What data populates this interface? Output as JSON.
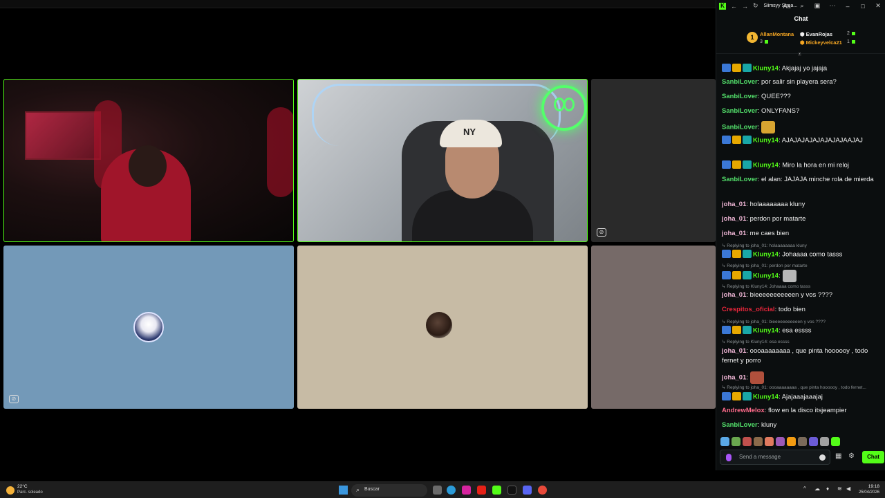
{
  "window": {
    "title": "Siimsyy Strea...",
    "chat_title": "Chat"
  },
  "gifters": {
    "first": {
      "rank": "1",
      "name": "AllanMontana",
      "count": "3"
    },
    "second": {
      "name": "EvanRojas",
      "count": "2"
    },
    "third": {
      "name": "Mickeyvelca21",
      "count": "1"
    }
  },
  "messages": [
    {
      "user": "Kluny14",
      "color": "#53fc18",
      "badges": true,
      "text": " Akjajaj yo jajaja"
    },
    {
      "user": "SanbiLover",
      "color": "#53e06b",
      "badges": false,
      "text": " por salir sin playera sera?"
    },
    {
      "user": "SanbiLover",
      "color": "#53e06b",
      "badges": false,
      "text": " QUEE???"
    },
    {
      "user": "SanbiLover",
      "color": "#53e06b",
      "badges": false,
      "text": " ONLYFANS?"
    },
    {
      "user": "SanbiLover",
      "color": "#53e06b",
      "badges": false,
      "text": ""
    },
    {
      "user": "Kluny14",
      "color": "#53fc18",
      "badges": true,
      "text": " AJAJAJAJAJAJAJAJAAJAJ"
    },
    {
      "user": "Kluny14",
      "color": "#53fc18",
      "badges": true,
      "text": " Miro la hora en mi reloj"
    },
    {
      "user": "SanbiLover",
      "color": "#53e06b",
      "badges": false,
      "text": " el alan: JAJAJA minche rola de mierda"
    },
    {
      "user": "joha_01",
      "color": "#f2b8d8",
      "badges": false,
      "text": " holaaaaaaaa kluny"
    },
    {
      "user": "joha_01",
      "color": "#f2b8d8",
      "badges": false,
      "text": " perdon por matarte"
    },
    {
      "user": "joha_01",
      "color": "#f2b8d8",
      "badges": false,
      "text": " me caes bien"
    },
    {
      "user": "Kluny14",
      "color": "#53fc18",
      "badges": true,
      "text": " Johaaaa como tasss",
      "reply": "Replying to joha_01: holaaaaaaaa kluny"
    },
    {
      "user": "Kluny14",
      "color": "#53fc18",
      "badges": true,
      "text": "",
      "reply": "Replying to joha_01: perdon por matarte"
    },
    {
      "user": "joha_01",
      "color": "#f2b8d8",
      "badges": false,
      "text": " bieeeeeeeeeeen y vos ????",
      "reply": "Replying to Kluny14: Johaaaa como tasss"
    },
    {
      "user": "Crespitos_oficial",
      "color": "#e8263b",
      "badges": false,
      "text": " todo bien"
    },
    {
      "user": "Kluny14",
      "color": "#53fc18",
      "badges": true,
      "text": " esa essss",
      "reply": "Replying to joha_01: bieeeeeeeeeeen y vos ????"
    },
    {
      "user": "joha_01",
      "color": "#f2b8d8",
      "badges": false,
      "text": " oooaaaaaaaa , que pinta hoooooy , todo fernet y porro",
      "reply": "Replying to Kluny14: esa essss"
    },
    {
      "user": "joha_01",
      "color": "#f2b8d8",
      "badges": false,
      "text": ""
    },
    {
      "user": "Kluny14",
      "color": "#53fc18",
      "badges": true,
      "text": " Ajajaaajaaajaj",
      "reply": "Replying to joha_01: oooaaaaaaaa , que pinta hoooooy , todo fernet..."
    },
    {
      "user": "AndrewMelox",
      "color": "#ff6b8b",
      "badges": false,
      "text": " flow en la disco itsjeampier"
    },
    {
      "user": "SanbiLover",
      "color": "#53e06b",
      "badges": false,
      "text": " kluny"
    }
  ],
  "input": {
    "placeholder": "Send a message",
    "send_label": "Chat"
  },
  "taskbar": {
    "temp": "22°C",
    "weather": "Parc. soleado",
    "search": "Buscar",
    "time": "19:18",
    "date": "25/04/2026"
  }
}
